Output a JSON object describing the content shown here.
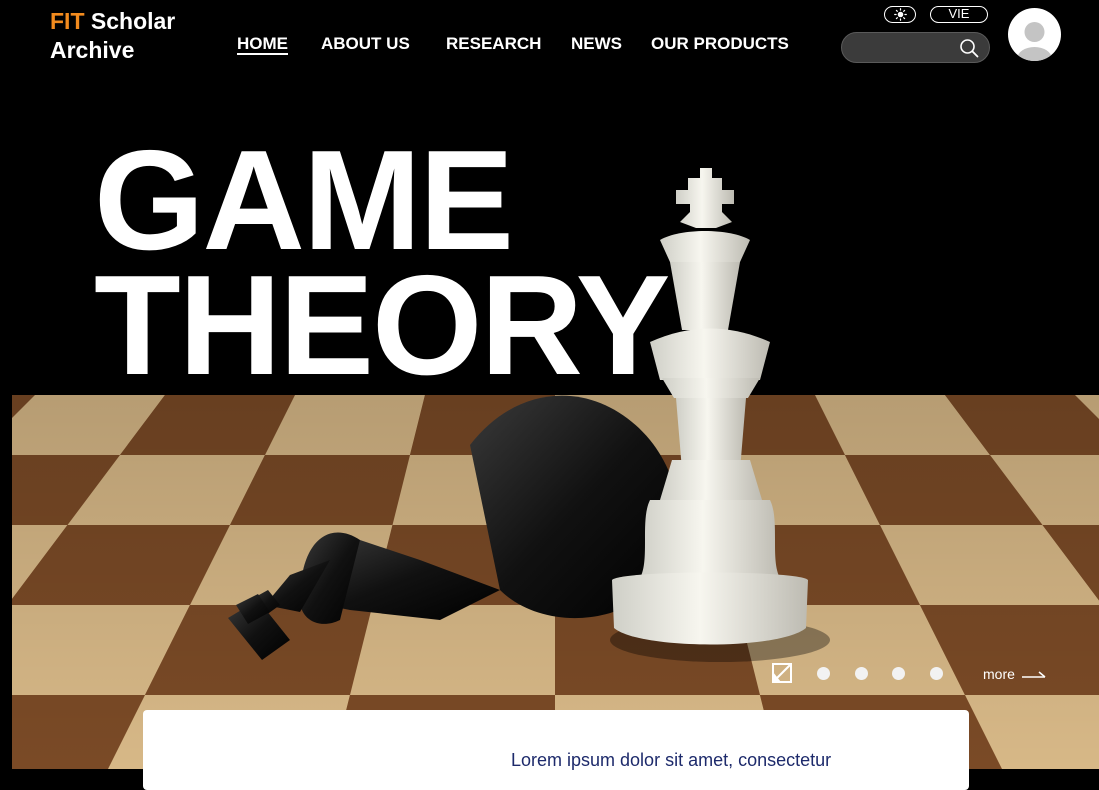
{
  "brand": {
    "accent_part": "FIT",
    "name_part": "Scholar",
    "line2": "Archive",
    "accent_color": "#f28b1e"
  },
  "nav": {
    "items": [
      {
        "label": "HOME",
        "active": true
      },
      {
        "label": "ABOUT US",
        "active": false
      },
      {
        "label": "RESEARCH",
        "active": false
      },
      {
        "label": "NEWS",
        "active": false
      },
      {
        "label": "OUR PRODUCTS",
        "active": false
      }
    ]
  },
  "header": {
    "theme_icon": "sun-icon",
    "language": "VIE",
    "search": {
      "value": "",
      "placeholder": "",
      "icon": "search-icon"
    },
    "avatar_icon": "user-icon"
  },
  "hero": {
    "title_line1": "GAME",
    "title_line2": "THEORY"
  },
  "carousel": {
    "pause_icon": "no-image-icon",
    "slide_count": 4,
    "more_label": "more",
    "more_icon": "long-arrow-right-icon"
  },
  "card": {
    "text": "Lorem ipsum dolor sit amet, consectetur"
  }
}
